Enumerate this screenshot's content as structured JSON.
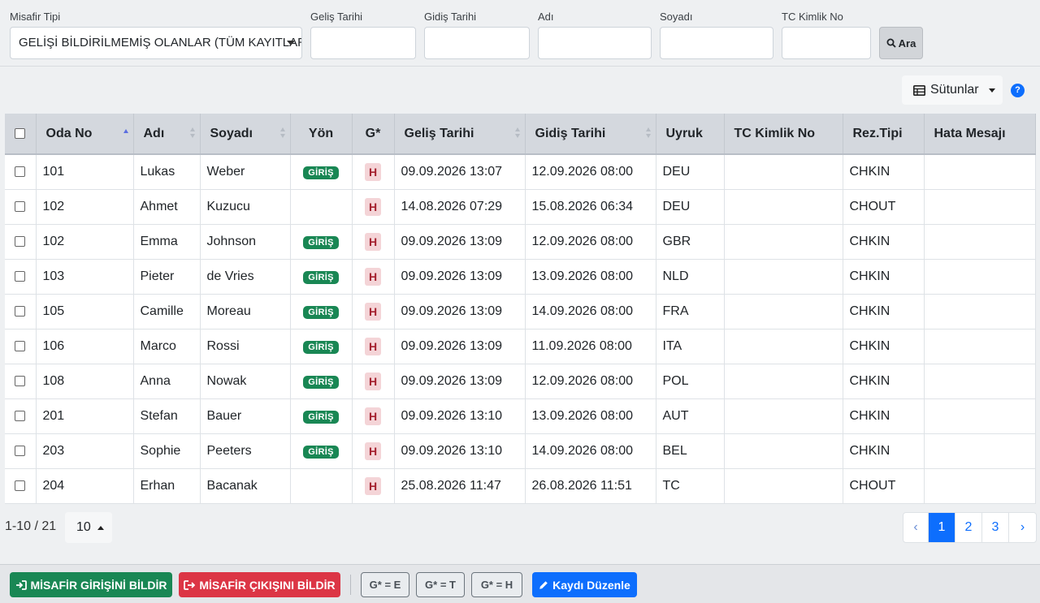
{
  "filters": {
    "guest_type": {
      "label": "Misafir Tipi",
      "value": "GELİŞİ BİLDİRİLMEMİŞ OLANLAR (TÜM KAYITLAR"
    },
    "arrival_date": {
      "label": "Geliş Tarihi",
      "value": ""
    },
    "departure_date": {
      "label": "Gidiş Tarihi",
      "value": ""
    },
    "first_name": {
      "label": "Adı",
      "value": ""
    },
    "last_name": {
      "label": "Soyadı",
      "value": ""
    },
    "tc_no": {
      "label": "TC Kimlik No",
      "value": ""
    },
    "search_label": "Ara"
  },
  "toolbar": {
    "columns_label": "Sütunlar",
    "help_label": "?"
  },
  "table": {
    "headers": [
      "Oda No",
      "Adı",
      "Soyadı",
      "Yön",
      "G*",
      "Geliş Tarihi",
      "Gidiş Tarihi",
      "Uyruk",
      "TC Kimlik No",
      "Rez.Tipi",
      "Hata Mesajı"
    ],
    "rows": [
      {
        "room": "101",
        "first": "Lukas",
        "last": "Weber",
        "dir": "GİRİŞ",
        "g": "H",
        "arr": "09.09.2026 13:07",
        "dep": "12.09.2026 08:00",
        "nat": "DEU",
        "tc": "",
        "rez": "CHKIN",
        "err": ""
      },
      {
        "room": "102",
        "first": "Ahmet",
        "last": "Kuzucu",
        "dir": "",
        "g": "H",
        "arr": "14.08.2026 07:29",
        "dep": "15.08.2026 06:34",
        "nat": "DEU",
        "tc": "",
        "rez": "CHOUT",
        "err": ""
      },
      {
        "room": "102",
        "first": "Emma",
        "last": "Johnson",
        "dir": "GİRİŞ",
        "g": "H",
        "arr": "09.09.2026 13:09",
        "dep": "12.09.2026 08:00",
        "nat": "GBR",
        "tc": "",
        "rez": "CHKIN",
        "err": ""
      },
      {
        "room": "103",
        "first": "Pieter",
        "last": "de Vries",
        "dir": "GİRİŞ",
        "g": "H",
        "arr": "09.09.2026 13:09",
        "dep": "13.09.2026 08:00",
        "nat": "NLD",
        "tc": "",
        "rez": "CHKIN",
        "err": ""
      },
      {
        "room": "105",
        "first": "Camille",
        "last": "Moreau",
        "dir": "GİRİŞ",
        "g": "H",
        "arr": "09.09.2026 13:09",
        "dep": "14.09.2026 08:00",
        "nat": "FRA",
        "tc": "",
        "rez": "CHKIN",
        "err": ""
      },
      {
        "room": "106",
        "first": "Marco",
        "last": "Rossi",
        "dir": "GİRİŞ",
        "g": "H",
        "arr": "09.09.2026 13:09",
        "dep": "11.09.2026 08:00",
        "nat": "ITA",
        "tc": "",
        "rez": "CHKIN",
        "err": ""
      },
      {
        "room": "108",
        "first": "Anna",
        "last": "Nowak",
        "dir": "GİRİŞ",
        "g": "H",
        "arr": "09.09.2026 13:09",
        "dep": "12.09.2026 08:00",
        "nat": "POL",
        "tc": "",
        "rez": "CHKIN",
        "err": ""
      },
      {
        "room": "201",
        "first": "Stefan",
        "last": "Bauer",
        "dir": "GİRİŞ",
        "g": "H",
        "arr": "09.09.2026 13:10",
        "dep": "13.09.2026 08:00",
        "nat": "AUT",
        "tc": "",
        "rez": "CHKIN",
        "err": ""
      },
      {
        "room": "203",
        "first": "Sophie",
        "last": "Peeters",
        "dir": "GİRİŞ",
        "g": "H",
        "arr": "09.09.2026 13:10",
        "dep": "14.09.2026 08:00",
        "nat": "BEL",
        "tc": "",
        "rez": "CHKIN",
        "err": ""
      },
      {
        "room": "204",
        "first": "Erhan",
        "last": "Bacanak",
        "dir": "",
        "g": "H",
        "arr": "25.08.2026 11:47",
        "dep": "26.08.2026 11:51",
        "nat": "TC",
        "tc": "",
        "rez": "CHOUT",
        "err": ""
      }
    ]
  },
  "pager": {
    "range_text": "1-10 / 21",
    "page_size": "10",
    "prev": "‹",
    "next": "›",
    "pages": [
      "1",
      "2",
      "3"
    ],
    "current": "1"
  },
  "footer": {
    "report_checkin": "MİSAFİR GİRİŞİNİ BİLDİR",
    "report_checkout": "MİSAFİR ÇIKIŞINI BİLDİR",
    "g_e": "G* = E",
    "g_t": "G* = T",
    "g_h": "G* = H",
    "edit_record": "Kaydı Düzenle"
  },
  "colors": {
    "primary": "#0d6efd",
    "success": "#198754",
    "danger": "#dc3545",
    "h_badge_bg": "#f4d4d7",
    "h_badge_fg": "#a4202e"
  }
}
